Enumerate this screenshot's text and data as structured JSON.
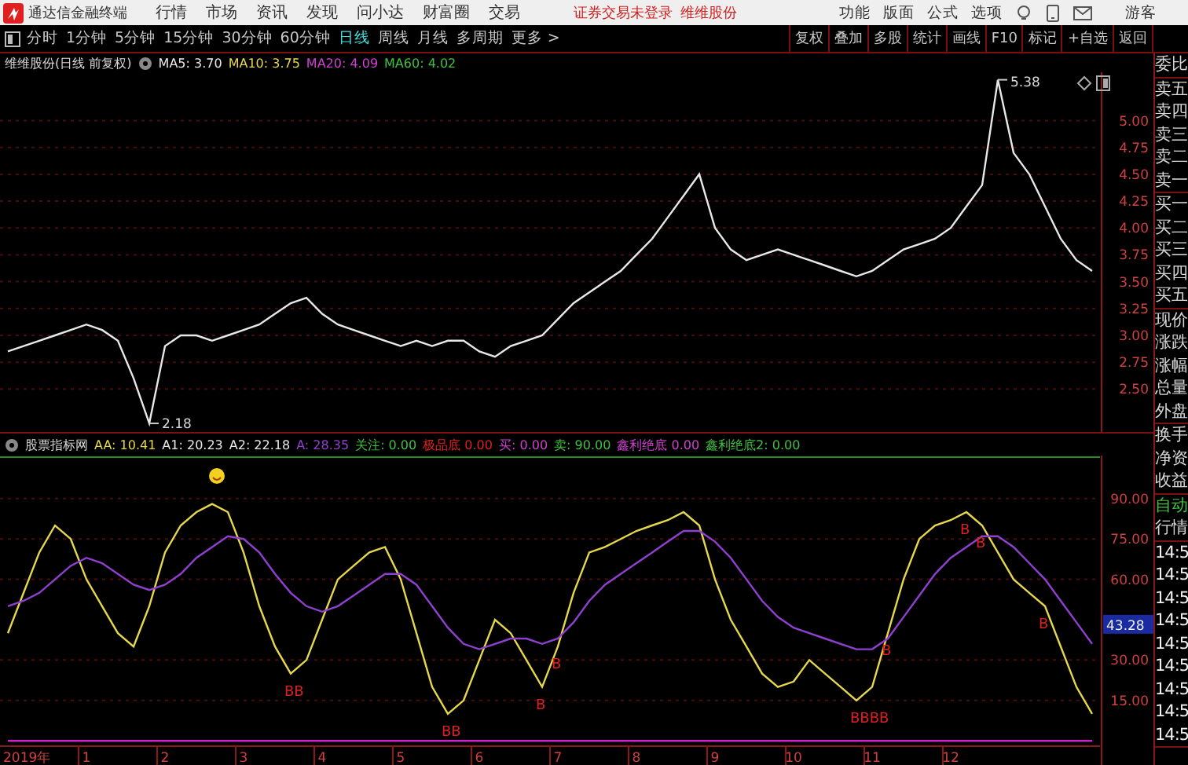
{
  "app_bar": {
    "title": "通达信金融终端",
    "menu": [
      "行情",
      "市场",
      "资讯",
      "发现",
      "问小达",
      "财富圈",
      "交易"
    ],
    "login_notice": "证券交易未登录",
    "stock_name": "维维股份",
    "right_menu": [
      "功能",
      "版面",
      "公式",
      "选项"
    ],
    "user": "游客"
  },
  "period_tabs": [
    {
      "label": "分时",
      "selected": false
    },
    {
      "label": "1分钟",
      "selected": false
    },
    {
      "label": "5分钟",
      "selected": false
    },
    {
      "label": "15分钟",
      "selected": false
    },
    {
      "label": "30分钟",
      "selected": false
    },
    {
      "label": "60分钟",
      "selected": false
    },
    {
      "label": "日线",
      "selected": true
    },
    {
      "label": "周线",
      "selected": false
    },
    {
      "label": "月线",
      "selected": false
    },
    {
      "label": "多周期",
      "selected": false
    },
    {
      "label": "更多 >",
      "selected": false
    }
  ],
  "chart_buttons": [
    "复权",
    "叠加",
    "多股",
    "统计",
    "画线",
    "F10",
    "标记",
    "+自选",
    "返回"
  ],
  "price_panel": {
    "title": "维维股份(日线 前复权)",
    "legend": [
      {
        "name": "MA5:",
        "value": "3.70",
        "color": "#e8e8e8"
      },
      {
        "name": "MA10:",
        "value": "3.75",
        "color": "#e6d84a"
      },
      {
        "name": "MA20:",
        "value": "4.09",
        "color": "#d040d0"
      },
      {
        "name": "MA60:",
        "value": "4.02",
        "color": "#40c040"
      }
    ],
    "chart_data": {
      "type": "line",
      "grid": true,
      "ylim": [
        2.1,
        5.45
      ],
      "yticks": [
        {
          "value": 5.0,
          "label": "5.00"
        },
        {
          "value": 4.75,
          "label": "4.75"
        },
        {
          "value": 4.5,
          "label": "4.50"
        },
        {
          "value": 4.25,
          "label": "4.25"
        },
        {
          "value": 4.0,
          "label": "4.00"
        },
        {
          "value": 3.75,
          "label": "3.75"
        },
        {
          "value": 3.5,
          "label": "3.50"
        },
        {
          "value": 3.25,
          "label": "3.25"
        },
        {
          "value": 3.0,
          "label": "3.00"
        },
        {
          "value": 2.75,
          "label": "2.75"
        },
        {
          "value": 2.5,
          "label": "2.50"
        }
      ],
      "series": [
        {
          "color": "#e8e8e8",
          "values": [
            2.85,
            2.9,
            2.95,
            3.0,
            3.05,
            3.1,
            3.05,
            2.95,
            2.6,
            2.18,
            2.9,
            3.0,
            3.0,
            2.95,
            3.0,
            3.05,
            3.1,
            3.2,
            3.3,
            3.35,
            3.2,
            3.1,
            3.05,
            3.0,
            2.95,
            2.9,
            2.95,
            2.9,
            2.95,
            2.95,
            2.85,
            2.8,
            2.9,
            2.95,
            3.0,
            3.15,
            3.3,
            3.4,
            3.5,
            3.6,
            3.75,
            3.9,
            4.1,
            4.3,
            4.5,
            4.0,
            3.8,
            3.7,
            3.75,
            3.8,
            3.75,
            3.7,
            3.65,
            3.6,
            3.55,
            3.6,
            3.7,
            3.8,
            3.85,
            3.9,
            4.0,
            4.2,
            4.4,
            5.38,
            4.7,
            4.5,
            4.2,
            3.9,
            3.7,
            3.6
          ]
        }
      ],
      "annotations": [
        "5.38",
        "2.18"
      ]
    }
  },
  "indicator_panel": {
    "title": "股票指标网",
    "legend": [
      {
        "name": "AA:",
        "value": "10.41",
        "color": "#e6d84a"
      },
      {
        "name": "A1:",
        "value": "20.23",
        "color": "#e8e8e8"
      },
      {
        "name": "A2:",
        "value": "22.18",
        "color": "#e8e8e8"
      },
      {
        "name": "A:",
        "value": "28.35",
        "color": "#9040d0"
      },
      {
        "name": "关注:",
        "value": "0.00",
        "color": "#40c040"
      },
      {
        "name": "极品底",
        "value": "0.00",
        "color": "#e02020"
      },
      {
        "name": "买:",
        "value": "0.00",
        "color": "#d040d0"
      },
      {
        "name": "卖:",
        "value": "90.00",
        "color": "#40c040"
      },
      {
        "name": "鑫利绝底",
        "value": "0.00",
        "color": "#d040d0"
      },
      {
        "name": "鑫利绝底2:",
        "value": "0.00",
        "color": "#40c040"
      }
    ],
    "current_value": "43.28",
    "year_label": "2019年",
    "chart_data": {
      "type": "line",
      "grid": true,
      "ylim": [
        -2,
        106
      ],
      "x": [
        0,
        0.2,
        0.4,
        0.6,
        0.8,
        1,
        1.2,
        1.4,
        1.6,
        1.8,
        2,
        2.2,
        2.4,
        2.6,
        2.8,
        3,
        3.2,
        3.4,
        3.6,
        3.8,
        4,
        4.2,
        4.4,
        4.6,
        4.8,
        5,
        5.2,
        5.4,
        5.6,
        5.8,
        6,
        6.2,
        6.4,
        6.6,
        6.8,
        7,
        7.2,
        7.4,
        7.6,
        7.8,
        8,
        8.2,
        8.4,
        8.6,
        8.8,
        9,
        9.2,
        9.4,
        9.6,
        9.8,
        10,
        10.2,
        10.4,
        10.6,
        10.8,
        11,
        11.2,
        11.4,
        11.6,
        11.8,
        12,
        12.2,
        12.4,
        12.6,
        12.8,
        13,
        13.2,
        13.4,
        13.6,
        13.8
      ],
      "yticks": [
        {
          "value": 90,
          "label": "90.00"
        },
        {
          "value": 75,
          "label": "75.00"
        },
        {
          "value": 60,
          "label": "60.00"
        },
        {
          "value": 30,
          "label": "30.00"
        },
        {
          "value": 15,
          "label": "15.00"
        }
      ],
      "xlim": [
        -0.1,
        13.9
      ],
      "xticks": [
        1,
        2,
        3,
        4,
        5,
        6,
        7,
        8,
        9,
        10,
        11,
        12
      ],
      "series": [
        {
          "color": "#d020d0",
          "values": [
            0,
            0,
            0,
            0,
            0,
            0,
            0,
            0,
            0,
            0,
            0,
            0,
            0,
            0,
            0,
            0,
            0,
            0,
            0,
            0,
            0,
            0,
            0,
            0,
            0,
            0,
            0,
            0,
            0,
            0,
            0,
            0,
            0,
            0,
            0,
            0,
            0,
            0,
            0,
            0,
            0,
            0,
            0,
            0,
            0,
            0,
            0,
            0,
            0,
            0,
            0,
            0,
            0,
            0,
            0,
            0,
            0,
            0,
            0,
            0,
            0,
            0,
            0,
            0,
            0,
            0,
            0,
            0,
            0,
            0
          ]
        },
        {
          "color": "#e6d84a",
          "values": [
            40,
            55,
            70,
            80,
            75,
            60,
            50,
            40,
            35,
            50,
            70,
            80,
            85,
            88,
            85,
            70,
            50,
            35,
            25,
            30,
            45,
            60,
            65,
            70,
            72,
            60,
            40,
            20,
            10,
            15,
            30,
            45,
            40,
            30,
            20,
            35,
            55,
            70,
            72,
            75,
            78,
            80,
            82,
            85,
            80,
            60,
            45,
            35,
            25,
            20,
            22,
            30,
            25,
            20,
            15,
            20,
            40,
            60,
            75,
            80,
            82,
            85,
            80,
            70,
            60,
            55,
            50,
            35,
            20,
            10
          ]
        },
        {
          "color": "#9040d0",
          "values": [
            50,
            52,
            55,
            60,
            65,
            68,
            66,
            62,
            58,
            56,
            58,
            62,
            68,
            72,
            76,
            75,
            70,
            62,
            55,
            50,
            48,
            50,
            54,
            58,
            62,
            62,
            58,
            50,
            42,
            36,
            34,
            36,
            38,
            38,
            36,
            38,
            44,
            52,
            58,
            62,
            66,
            70,
            74,
            78,
            78,
            74,
            68,
            60,
            52,
            46,
            42,
            40,
            38,
            36,
            34,
            34,
            38,
            46,
            54,
            62,
            68,
            72,
            76,
            76,
            72,
            66,
            60,
            52,
            44,
            36
          ]
        }
      ],
      "annotations": [
        {
          "x": 3.6,
          "y": 25,
          "text": "BB"
        },
        {
          "x": 5.6,
          "y": 10,
          "text": "BB"
        },
        {
          "x": 6.8,
          "y": 20,
          "text": "B"
        },
        {
          "x": 7,
          "y": 35,
          "text": "B"
        },
        {
          "x": 10.8,
          "y": 15,
          "text": "BBBB"
        },
        {
          "x": 11.2,
          "y": 40,
          "text": "B"
        },
        {
          "x": 12.2,
          "y": 85,
          "text": "B"
        },
        {
          "x": 12.4,
          "y": 80,
          "text": "B"
        },
        {
          "x": 13.2,
          "y": 50,
          "text": "B"
        }
      ]
    }
  },
  "side_panel": {
    "sections": [
      [
        {
          "text": "委比",
          "kind": "label"
        }
      ],
      [
        {
          "text": "卖五",
          "kind": "label"
        },
        {
          "text": "卖四",
          "kind": "label"
        },
        {
          "text": "卖三",
          "kind": "label"
        },
        {
          "text": "卖二",
          "kind": "label"
        },
        {
          "text": "卖一",
          "kind": "label"
        }
      ],
      [
        {
          "text": "买一",
          "kind": "label"
        },
        {
          "text": "买二",
          "kind": "label"
        },
        {
          "text": "买三",
          "kind": "label"
        },
        {
          "text": "买四",
          "kind": "label"
        },
        {
          "text": "买五",
          "kind": "label"
        }
      ],
      [
        {
          "text": "现价",
          "kind": "label"
        },
        {
          "text": "涨跌",
          "kind": "label"
        },
        {
          "text": "涨幅",
          "kind": "label"
        },
        {
          "text": "总量",
          "kind": "label"
        },
        {
          "text": "外盘",
          "kind": "label"
        }
      ],
      [
        {
          "text": "换手",
          "kind": "label"
        },
        {
          "text": "净资",
          "kind": "label"
        },
        {
          "text": "收益",
          "kind": "label"
        }
      ],
      [
        {
          "text": "自动",
          "kind": "mode"
        },
        {
          "text": "行情",
          "kind": "label"
        }
      ],
      [
        {
          "text": "14:5",
          "kind": "time"
        },
        {
          "text": "14:5",
          "kind": "time"
        },
        {
          "text": "14:5",
          "kind": "time"
        },
        {
          "text": "14:5",
          "kind": "time"
        },
        {
          "text": "14:5",
          "kind": "time"
        },
        {
          "text": "14:5",
          "kind": "time"
        },
        {
          "text": "14:5",
          "kind": "time"
        },
        {
          "text": "14:5",
          "kind": "time"
        },
        {
          "text": "14:5",
          "kind": "time"
        }
      ]
    ]
  }
}
